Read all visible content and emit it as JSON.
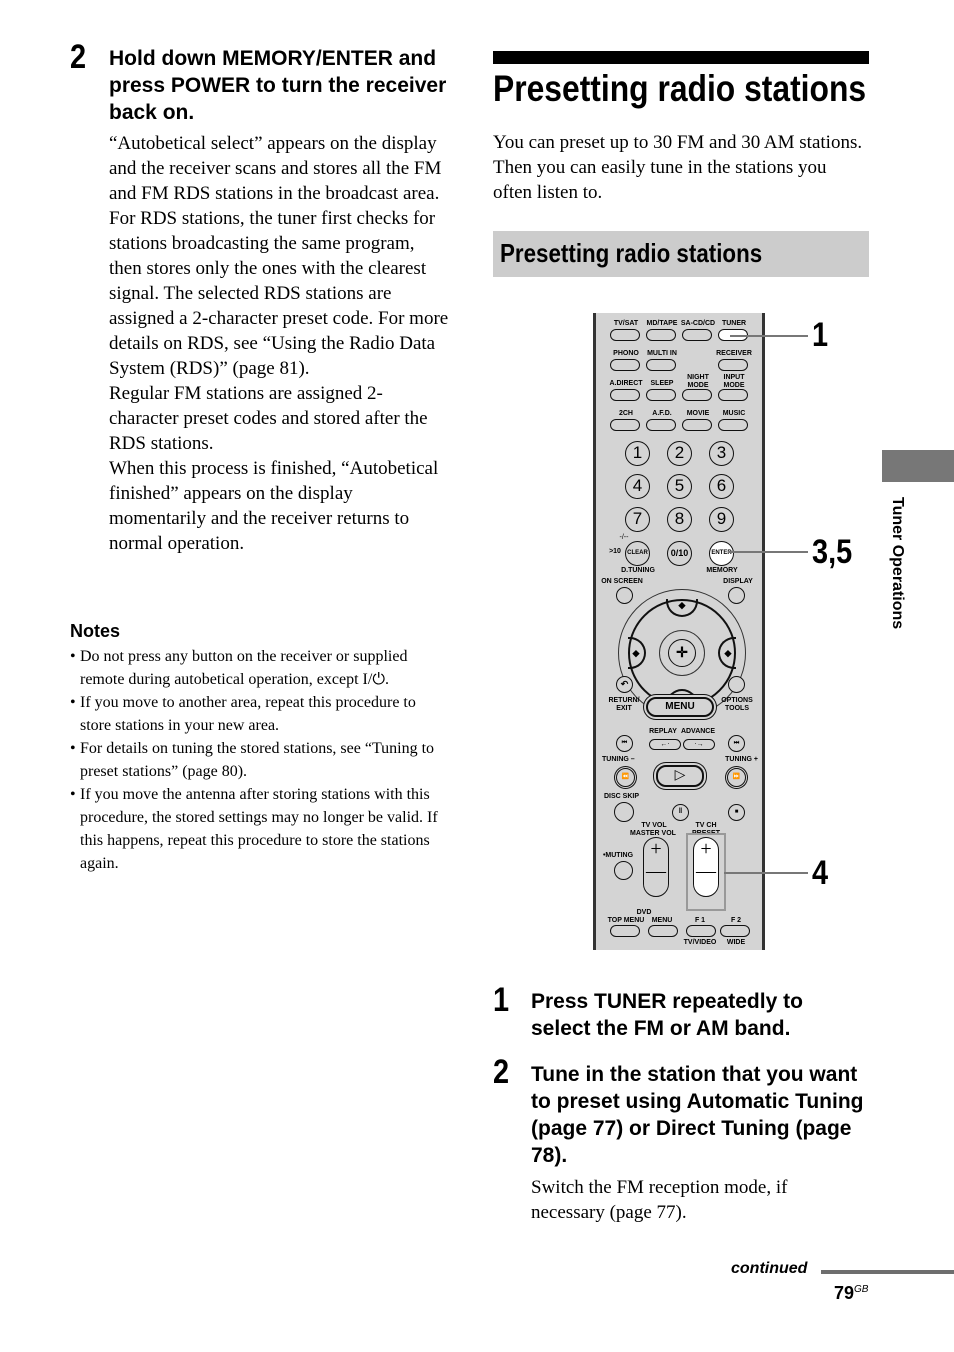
{
  "left": {
    "step": {
      "number": "2",
      "heading": "Hold down MEMORY/ENTER and press POWER to turn the receiver back on."
    },
    "paragraphs": [
      "“Autobetical select” appears on the display and the receiver scans and stores all the FM and FM RDS stations in the broadcast area.",
      "For RDS stations, the tuner first checks for stations broadcasting the same program, then stores only the ones with the clearest signal. The selected RDS stations are assigned a 2-character preset code. For more details on RDS, see “Using the Radio Data System (RDS)” (page 81).",
      "Regular FM stations are assigned 2-character preset codes and stored after the RDS stations.",
      "When this process is finished, “Autobetical finished” appears on the display momentarily and the receiver returns to normal operation."
    ],
    "notes": {
      "title": "Notes",
      "items": [
        "Do not press any button on the receiver or supplied remote during autobetical operation, except I/⏻.",
        "If you move to another area, repeat this procedure to store stations in your new area.",
        "For details on tuning the stored stations, see “Tuning to preset stations” (page 80).",
        "If you move the antenna after storing stations with this procedure, the stored settings may no longer be valid. If this happens, repeat this procedure to store the stations again."
      ]
    }
  },
  "right": {
    "title": "Presetting radio stations",
    "intro": "You can preset up to 30 FM and 30 AM stations. Then you can easily tune in the stations you often listen to.",
    "subtitle": "Presetting radio stations",
    "callouts": [
      "1",
      "3,5",
      "4"
    ],
    "steps": [
      {
        "number": "1",
        "heading": "Press TUNER repeatedly to select the FM or AM band.",
        "body": ""
      },
      {
        "number": "2",
        "heading": "Tune in the station that you want to preset using Automatic Tuning (page 77) or Direct Tuning (page 78).",
        "body": "Switch the FM reception mode, if necessary (page 77)."
      }
    ]
  },
  "remote": {
    "row1": [
      "TV/SAT",
      "MD/TAPE",
      "SA-CD/CD",
      "TUNER"
    ],
    "row2": [
      "PHONO",
      "MULTI IN",
      "RECEIVER"
    ],
    "row3": [
      "A.DIRECT",
      "SLEEP",
      "NIGHT MODE",
      "INPUT MODE"
    ],
    "row4": [
      "2CH",
      "A.F.D.",
      "MOVIE",
      "MUSIC"
    ],
    "numbers": [
      "1",
      "2",
      "3",
      "4",
      "5",
      "6",
      "7",
      "8",
      "9"
    ],
    "dash": "-/--",
    "gt10": ">10",
    "clear": "CLEAR",
    "zero": "0/10",
    "enter": "ENTER",
    "d_tuning": "D.TUNING",
    "memory": "MEMORY",
    "on_screen": "ON SCREEN",
    "display": "DISPLAY",
    "return_exit": "RETURN/ EXIT",
    "menu": "MENU",
    "options_tools": "OPTIONS TOOLS",
    "replay": "REPLAY",
    "advance": "ADVANCE",
    "tuning_minus": "TUNING –",
    "tuning_plus": "TUNING +",
    "disc_skip": "DISC SKIP",
    "tv_vol": "TV VOL",
    "master_vol": "MASTER VOL",
    "tv_ch": "TV CH",
    "preset": "PRESET",
    "muting": "•MUTING",
    "dvd": "DVD",
    "top_menu": "TOP MENU",
    "dvd_menu": "MENU",
    "f1": "F 1",
    "f2": "F 2",
    "tv_video": "TV/VIDEO",
    "wide": "WIDE"
  },
  "side_tab": "Tuner Operations",
  "footer": {
    "continued": "continued",
    "page": "79",
    "page_suffix": "GB"
  }
}
